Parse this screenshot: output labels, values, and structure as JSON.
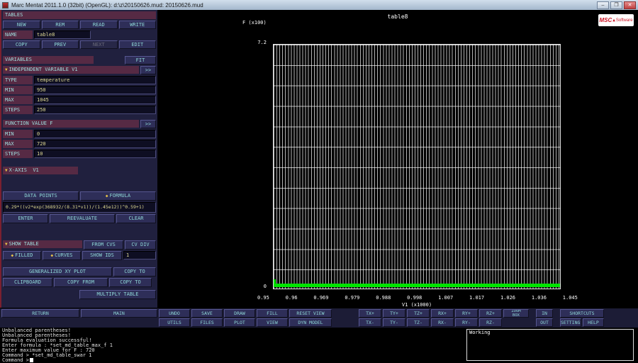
{
  "window": {
    "title": "Marc Mentat 2011.1.0 (32bit) (OpenGL): d:\\z\\20150626.mud: 20150626.mud"
  },
  "icons": {
    "collapse_triangle": "▼",
    "diamond_on": "◆",
    "window_minimize": "–",
    "window_maximize": "❐",
    "window_close": "✕",
    "logo_triangle": "▲"
  },
  "panel": {
    "tables_header": "TABLES",
    "new": "NEW",
    "rem": "REM",
    "read": "READ",
    "write": "WRITE",
    "name_label": "NAME",
    "name_value": "table8",
    "copy": "COPY",
    "prev": "PREV",
    "next": "NEXT",
    "edit": "EDIT",
    "variables_header": "VARIABLES",
    "fit": "FIT",
    "indep_header": "INDEPENDENT VARIABLE V1",
    "expand": ">>",
    "type_label": "TYPE",
    "type_value": "temperature",
    "v1_min_label": "MIN",
    "v1_min": "950",
    "v1_max_label": "MAX",
    "v1_max": "1045",
    "v1_steps_label": "STEPS",
    "v1_steps": "250",
    "func_header": "FUNCTION VALUE F",
    "f_min_label": "MIN",
    "f_min": "0",
    "f_max_label": "MAX",
    "f_max": "720",
    "f_steps_label": "STEPS",
    "f_steps": "10",
    "x_axis": "X-AXIS  V1",
    "data_points": "DATA POINTS",
    "formula_toggle": "FORMULA",
    "formula": "0.29*((v2*exp(368932/(8.31*v1))/(1.45e12))^0.59+1)",
    "enter": "ENTER",
    "reevaluate": "REEVALUATE",
    "clear": "CLEAR",
    "show_table": "SHOW TABLE",
    "from_cvs": "FROM CVS",
    "cv_div": "CV DIV",
    "filled": "FILLED",
    "curves": "CURVES",
    "show_ids": "SHOW IDS",
    "show_ids_value": "1",
    "generalized": "GENERALIZED XY PLOT",
    "copy_to": "COPY TO",
    "clipboard": "CLIPBOARD",
    "copy_from": "COPY FROM",
    "multiply_table": "MULTIPLY TABLE",
    "return": "RETURN",
    "main": "MAIN"
  },
  "plot": {
    "logo_main": "MSC",
    "logo_sub": "Software"
  },
  "chart_data": {
    "type": "line",
    "title": "table8",
    "xlabel": "V1 (x1000)",
    "ylabel": "F (x100)",
    "xlim": [
      0.95,
      1.045
    ],
    "ylim": [
      0,
      7.2
    ],
    "x_ticks": [
      "0.95",
      "0.96",
      "0.969",
      "0.979",
      "0.988",
      "0.998",
      "1.007",
      "1.017",
      "1.026",
      "1.036",
      "1.045"
    ],
    "grid": true,
    "legend": "none",
    "series": [
      {
        "name": "table8",
        "color": "#00e400",
        "x": [
          0.95,
          0.96,
          0.969,
          0.979,
          0.988,
          0.998,
          1.007,
          1.017,
          1.026,
          1.036,
          1.045
        ],
        "y": [
          0.12,
          0.09,
          0.08,
          0.07,
          0.06,
          0.06,
          0.05,
          0.05,
          0.05,
          0.04,
          0.04
        ]
      }
    ]
  },
  "toolbar": {
    "row1": [
      "UNDO",
      "SAVE",
      "DRAW",
      "FILL",
      "RESET VIEW",
      "TX+",
      "TY+",
      "TZ+",
      "RX+",
      "RY+",
      "RZ+",
      "ZOOM",
      "BOX",
      "IN",
      "SHORTCUTS"
    ],
    "row2": [
      "UTILS",
      "FILES",
      "PLOT",
      "VIEW",
      "DYN MODEL",
      "TX-",
      "TY-",
      "TZ-",
      "RX-",
      "RY-",
      "RZ-",
      "OUT",
      "SETTINGS",
      "HELP"
    ]
  },
  "console": {
    "lines": [
      "Unbalanced parentheses!",
      "Unbalanced parentheses!",
      "Formula evaluation successful!",
      "Enter formula : *set_md_table_max_f 1",
      "Enter maximum value for F : 720",
      "Command > *set_md_table_swar 1",
      "Command >"
    ],
    "status": "Working"
  }
}
